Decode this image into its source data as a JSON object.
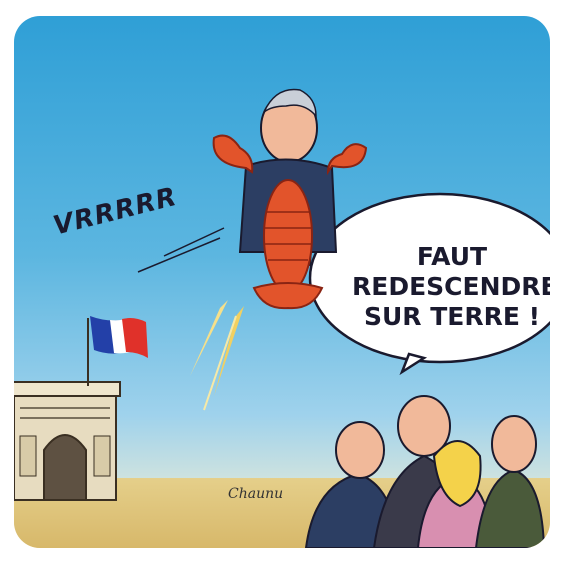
{
  "scene": {
    "sound_effect": "VRRRRR",
    "speech_bubble": {
      "lines": [
        "FAUT",
        "REDESCENDRE",
        "SUR TERRE !"
      ]
    },
    "signature": "Chaunu",
    "colors": {
      "sky_top": "#2f9fd6",
      "sky_bottom": "#9fd2ec",
      "ground": "#e5cf8a",
      "lobster": "#e2542b",
      "suit": "#2c3e63",
      "flag_blue": "#2340a8",
      "flag_white": "#ffffff",
      "flag_red": "#e0312a",
      "arch_stone": "#e7dcc0"
    },
    "icons": [
      "lobster-costume",
      "rocket-flames",
      "french-flag",
      "arc-de-triomphe",
      "speech-bubble"
    ]
  }
}
